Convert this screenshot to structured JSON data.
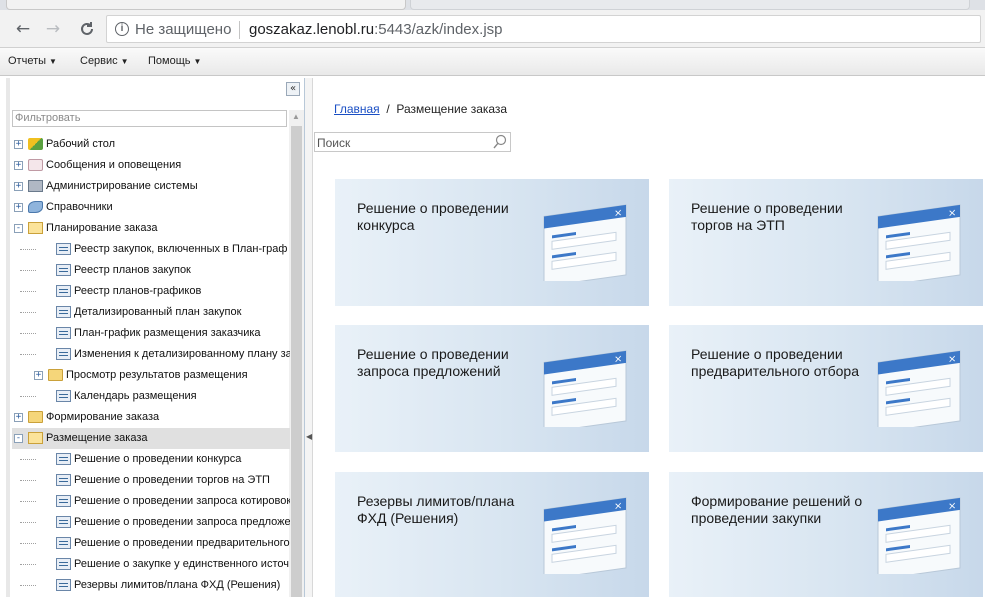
{
  "browser": {
    "back_icon": "←",
    "forward_icon": "→",
    "reload_icon": "C",
    "security_label": "Не защищено",
    "url_host": "goszakaz.lenobl.ru",
    "url_rest": ":5443/azk/index.jsp"
  },
  "menubar": {
    "items": [
      {
        "label": "Отчеты"
      },
      {
        "label": "Сервис"
      },
      {
        "label": "Помощь"
      }
    ]
  },
  "sidebar": {
    "collapse_glyph": "«",
    "filter_placeholder": "Фильтровать",
    "tree": [
      {
        "label": "Рабочий стол",
        "level": 0,
        "toggle": "+",
        "icon": "desktop-icon"
      },
      {
        "label": "Сообщения и оповещения",
        "level": 0,
        "toggle": "+",
        "icon": "mail-icon"
      },
      {
        "label": "Администрирование системы",
        "level": 0,
        "toggle": "+",
        "icon": "admin-icon"
      },
      {
        "label": "Справочники",
        "level": 0,
        "toggle": "+",
        "icon": "reference-icon"
      },
      {
        "label": "Планирование заказа",
        "level": 0,
        "toggle": "−",
        "icon": "folder-open-icon"
      },
      {
        "label": "Реестр закупок, включенных в План-граф",
        "level": 1,
        "icon": "document-icon"
      },
      {
        "label": "Реестр планов закупок",
        "level": 1,
        "icon": "document-icon"
      },
      {
        "label": "Реестр планов-графиков",
        "level": 1,
        "icon": "document-icon"
      },
      {
        "label": "Детализированный план закупок",
        "level": 1,
        "icon": "document-icon"
      },
      {
        "label": "План-график размещения заказчика",
        "level": 1,
        "icon": "document-icon"
      },
      {
        "label": "Изменения к детализированному плану за",
        "level": 1,
        "icon": "document-icon"
      },
      {
        "label": "Просмотр результатов размещения",
        "level": 1,
        "toggle": "+",
        "icon": "folder-icon"
      },
      {
        "label": "Календарь размещения",
        "level": 1,
        "icon": "document-icon"
      },
      {
        "label": "Формирование заказа",
        "level": 0,
        "toggle": "+",
        "icon": "folder-icon"
      },
      {
        "label": "Размещение заказа",
        "level": 0,
        "toggle": "−",
        "icon": "folder-open-icon",
        "selected": true
      },
      {
        "label": "Решение о проведении конкурса",
        "level": 1,
        "icon": "document-icon"
      },
      {
        "label": "Решение о проведении торгов на ЭТП",
        "level": 1,
        "icon": "document-icon"
      },
      {
        "label": "Решение о проведении запроса котировок",
        "level": 1,
        "icon": "document-icon"
      },
      {
        "label": "Решение о проведении запроса предложе",
        "level": 1,
        "icon": "document-icon"
      },
      {
        "label": "Решение о проведении предварительного",
        "level": 1,
        "icon": "document-icon"
      },
      {
        "label": "Решение о закупке у единственного источ",
        "level": 1,
        "icon": "document-icon"
      },
      {
        "label": "Резервы лимитов/плана ФХД (Решения)",
        "level": 1,
        "icon": "document-icon"
      }
    ]
  },
  "main": {
    "breadcrumb_home": "Главная",
    "breadcrumb_sep": "/",
    "breadcrumb_current": "Размещение заказа",
    "search_placeholder": "Поиск",
    "tiles": [
      {
        "title": "Решение о проведении конкурса"
      },
      {
        "title": "Решение о проведении торгов на ЭТП"
      },
      {
        "title": "Решение о проведении запроса предложений"
      },
      {
        "title": "Решение о проведении предварительного отбора"
      },
      {
        "title": "Резервы лимитов/плана ФХД (Решения)"
      },
      {
        "title": "Формирование решений о проведении закупки"
      }
    ]
  },
  "colors": {
    "link": "#1a4fc4",
    "tile_gradient_start": "#e9f1f8",
    "tile_gradient_end": "#c7d8ea",
    "window_title_bar": "#3c78c8"
  }
}
